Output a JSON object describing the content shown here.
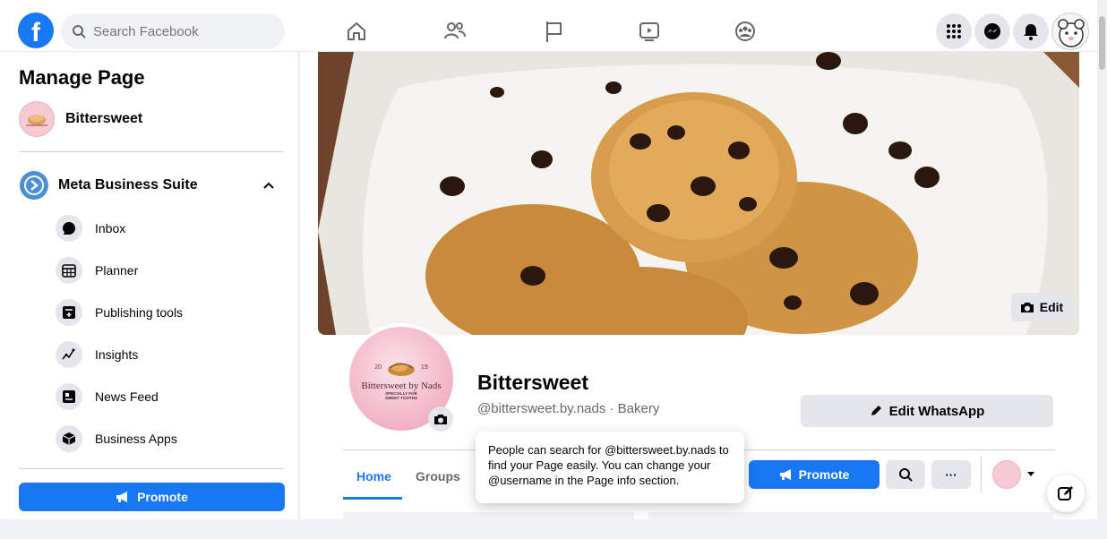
{
  "topbar": {
    "logo": "f",
    "search_placeholder": "Search Facebook",
    "nav_icons": [
      "home-icon",
      "people-icon",
      "flag-icon",
      "video-icon",
      "groups-icon"
    ],
    "right_icons": [
      "menu-grid-icon",
      "messenger-icon",
      "notifications-icon"
    ]
  },
  "sidebar": {
    "title": "Manage Page",
    "page_name": "Bittersweet",
    "suite_label": "Meta Business Suite",
    "items": [
      {
        "label": "Inbox",
        "icon": "chat-bubble-icon"
      },
      {
        "label": "Planner",
        "icon": "calendar-icon"
      },
      {
        "label": "Publishing tools",
        "icon": "publishing-icon"
      },
      {
        "label": "Insights",
        "icon": "insights-icon"
      },
      {
        "label": "News Feed",
        "icon": "news-feed-icon"
      },
      {
        "label": "Business Apps",
        "icon": "cube-icon"
      }
    ],
    "promote_label": "Promote"
  },
  "page": {
    "cover_edit_label": "Edit",
    "profile_logo_line1": "Bittersweet by Nads",
    "profile_logo_line2": "SPECIALLY FOR SWEET TOOTHS",
    "profile_logo_year_left": "20",
    "profile_logo_year_right": "19",
    "name": "Bittersweet",
    "handle_line": "@bittersweet.by.nads · Bakery",
    "edit_whatsapp_label": "Edit WhatsApp",
    "tabs": [
      "Home",
      "Groups"
    ],
    "promote_label": "Promote",
    "more_label": "···"
  },
  "tooltip": {
    "text": "People can search for @bittersweet.by.nads to find your Page easily. You can change your @username in the Page info section."
  },
  "colors": {
    "brand_blue": "#1877f2",
    "background": "#f0f2f5",
    "button_gray": "#e4e6eb"
  }
}
